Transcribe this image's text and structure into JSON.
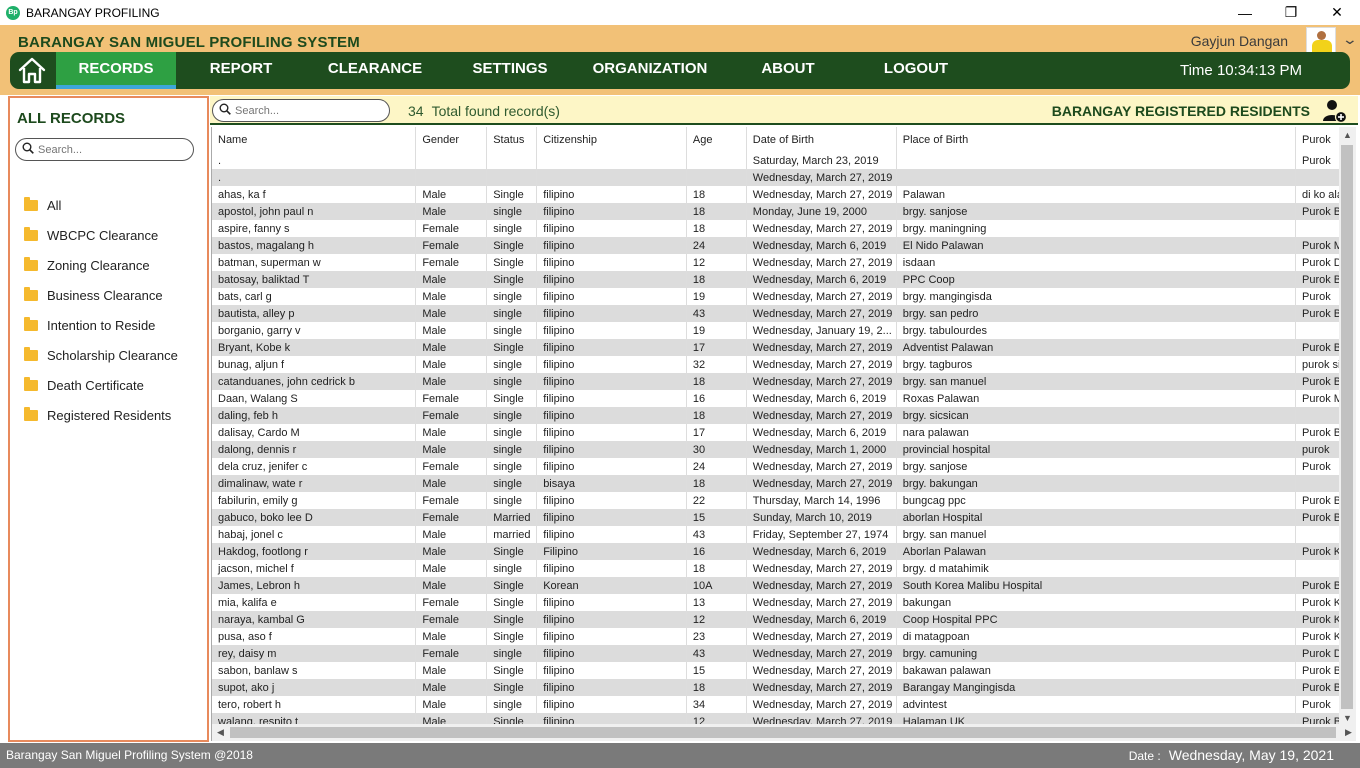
{
  "window": {
    "title": "BARANGAY PROFILING",
    "icon_text": "Bp",
    "controls": [
      "—",
      "❐",
      "✕"
    ]
  },
  "header": {
    "system_title": "BARANGAY SAN MIGUEL PROFILING SYSTEM",
    "username": "Gayjun Dangan",
    "nav": [
      "RECORDS",
      "REPORT",
      "CLEARANCE",
      "SETTINGS",
      "ORGANIZATION",
      "ABOUT",
      "LOGOUT"
    ],
    "active_nav": "RECORDS",
    "time_label": "Time",
    "time_value": "10:34:13 PM",
    "colors": {
      "header_bg": "#f2c177",
      "nav_bg": "#1e4d1e",
      "active_nav_bg": "#2ea043"
    }
  },
  "sidebar": {
    "title": "ALL RECORDS",
    "search_placeholder": "Search...",
    "items": [
      "All",
      "WBCPC Clearance",
      "Zoning Clearance",
      "Business Clearance",
      "Intention to Reside",
      "Scholarship Clearance",
      "Death Certificate",
      "Registered Residents"
    ]
  },
  "toolbar": {
    "search_placeholder": "Search...",
    "count": "34",
    "count_label": "Total found record(s)",
    "section_title": "BARANGAY REGISTERED RESIDENTS"
  },
  "table": {
    "columns": [
      "Name",
      "Gender",
      "Status",
      "Citizenship",
      "Age",
      "Date of Birth",
      "Place of Birth",
      "Purok"
    ],
    "rows": [
      [
        ".",
        "",
        "",
        "",
        "",
        "Saturday, March 23, 2019",
        "",
        "Purok"
      ],
      [
        ".",
        "",
        "",
        "",
        "",
        "Wednesday, March 27, 2019",
        "",
        ""
      ],
      [
        "ahas, ka f",
        "Male",
        "Single",
        "filipino",
        "18",
        "Wednesday, March 27, 2019",
        "Palawan",
        "di ko ala"
      ],
      [
        "apostol, john paul n",
        "Male",
        "single",
        "filipino",
        "18",
        "Monday, June 19, 2000",
        "brgy. sanjose",
        "Purok B"
      ],
      [
        "aspire, fanny s",
        "Female",
        "single",
        "filipino",
        "18",
        "Wednesday, March 27, 2019",
        "brgy. maningning",
        ""
      ],
      [
        "bastos, magalang h",
        "Female",
        "Single",
        "filipino",
        "24",
        "Wednesday, March 6, 2019",
        "El Nido Palawan",
        "Purok M"
      ],
      [
        "batman, superman w",
        "Female",
        "Single",
        "filipino",
        "12",
        "Wednesday, March 27, 2019",
        "isdaan",
        "Purok D"
      ],
      [
        "batosay, baliktad T",
        "Male",
        "Single",
        "filipino",
        "18",
        "Wednesday, March 6, 2019",
        "PPC Coop",
        "Purok B"
      ],
      [
        "bats, carl g",
        "Male",
        "single",
        "filipino",
        "19",
        "Wednesday, March 27, 2019",
        "brgy. mangingisda",
        "Purok"
      ],
      [
        "bautista, alley p",
        "Male",
        "single",
        "filipino",
        "43",
        "Wednesday, March 27, 2019",
        "brgy. san pedro",
        "Purok B"
      ],
      [
        "borganio, garry v",
        "Male",
        "single",
        "filipino",
        "19",
        "Wednesday, January 19, 2...",
        "brgy. tabulourdes",
        ""
      ],
      [
        "Bryant, Kobe k",
        "Male",
        "Single",
        "filipino",
        "17",
        "Wednesday, March 27, 2019",
        "Adventist Palawan",
        "Purok B"
      ],
      [
        "bunag, aljun f",
        "Male",
        "single",
        "filipino",
        "32",
        "Wednesday, March 27, 2019",
        "brgy. tagburos",
        "purok si"
      ],
      [
        "catanduanes, john cedrick b",
        "Male",
        "single",
        "filipino",
        "18",
        "Wednesday, March 27, 2019",
        "brgy. san manuel",
        "Purok B"
      ],
      [
        "Daan, Walang S",
        "Female",
        "Single",
        "filipino",
        "16",
        "Wednesday, March 6, 2019",
        "Roxas Palawan",
        "Purok M"
      ],
      [
        "daling, feb h",
        "Female",
        "single",
        "filipino",
        "18",
        "Wednesday, March 27, 2019",
        "brgy. sicsican",
        ""
      ],
      [
        "dalisay, Cardo M",
        "Male",
        "single",
        "filipino",
        "17",
        "Wednesday, March 6, 2019",
        "nara palawan",
        "Purok B"
      ],
      [
        "dalong, dennis r",
        "Male",
        "single",
        "filipino",
        "30",
        "Wednesday, March 1, 2000",
        "provincial hospital",
        "purok"
      ],
      [
        "dela cruz, jenifer c",
        "Female",
        "single",
        "filipino",
        "24",
        "Wednesday, March 27, 2019",
        "brgy. sanjose",
        "Purok"
      ],
      [
        "dimalinaw, wate r",
        "Male",
        "single",
        "bisaya",
        "18",
        "Wednesday, March 27, 2019",
        "brgy. bakungan",
        ""
      ],
      [
        "fabilurin, emily g",
        "Female",
        "single",
        "filipino",
        "22",
        "Thursday, March 14, 1996",
        "bungcag ppc",
        "Purok B"
      ],
      [
        "gabuco, boko lee D",
        "Female",
        "Married",
        "filipino",
        "15",
        "Sunday, March 10, 2019",
        "aborlan Hospital",
        "Purok B"
      ],
      [
        "habaj, jonel c",
        "Male",
        "married",
        "filipino",
        "43",
        "Friday, September 27, 1974",
        "brgy. san manuel",
        ""
      ],
      [
        "Hakdog, footlong r",
        "Male",
        "Single",
        "Filipino",
        "16",
        "Wednesday, March 6, 2019",
        "Aborlan Palawan",
        "Purok K"
      ],
      [
        "jacson, michel f",
        "Male",
        "single",
        "filipino",
        "18",
        "Wednesday, March 27, 2019",
        "brgy. d matahimik",
        ""
      ],
      [
        "James, Lebron h",
        "Male",
        "Single",
        "Korean",
        "10A",
        "Wednesday, March 27, 2019",
        "South Korea Malibu Hospital",
        "Purok B"
      ],
      [
        "mia, kalifa e",
        "Female",
        "Single",
        "filipino",
        "13",
        "Wednesday, March 27, 2019",
        "bakungan",
        "Purok K"
      ],
      [
        "naraya, kambal G",
        "Female",
        "Single",
        "filipino",
        "12",
        "Wednesday, March 6, 2019",
        "Coop Hospital PPC",
        "Purok K"
      ],
      [
        "pusa, aso f",
        "Male",
        "Single",
        "filipino",
        "23",
        "Wednesday, March 27, 2019",
        "di matagpoan",
        "Purok K"
      ],
      [
        "rey, daisy m",
        "Female",
        "single",
        "filipino",
        "43",
        "Wednesday, March 27, 2019",
        "brgy. camuning",
        "Purok D"
      ],
      [
        "sabon, banlaw s",
        "Male",
        "Single",
        "filipino",
        "15",
        "Wednesday, March 27, 2019",
        "bakawan palawan",
        "Purok B"
      ],
      [
        "supot, ako j",
        "Male",
        "Single",
        "filipino",
        "18",
        "Wednesday, March 27, 2019",
        "Barangay Mangingisda",
        "Purok B"
      ],
      [
        "tero, robert h",
        "Male",
        "single",
        "filipino",
        "34",
        "Wednesday, March 27, 2019",
        "advintest",
        "Purok"
      ],
      [
        "walang, respito t",
        "Male",
        "Single",
        "filipino",
        "12",
        "Wednesday, March 27, 2019",
        "Halaman UK",
        "Purok B"
      ]
    ]
  },
  "footer": {
    "copyright": "Barangay San Miguel Profiling System @2018",
    "date_label": "Date :",
    "date_value": "Wednesday, May 19, 2021"
  }
}
